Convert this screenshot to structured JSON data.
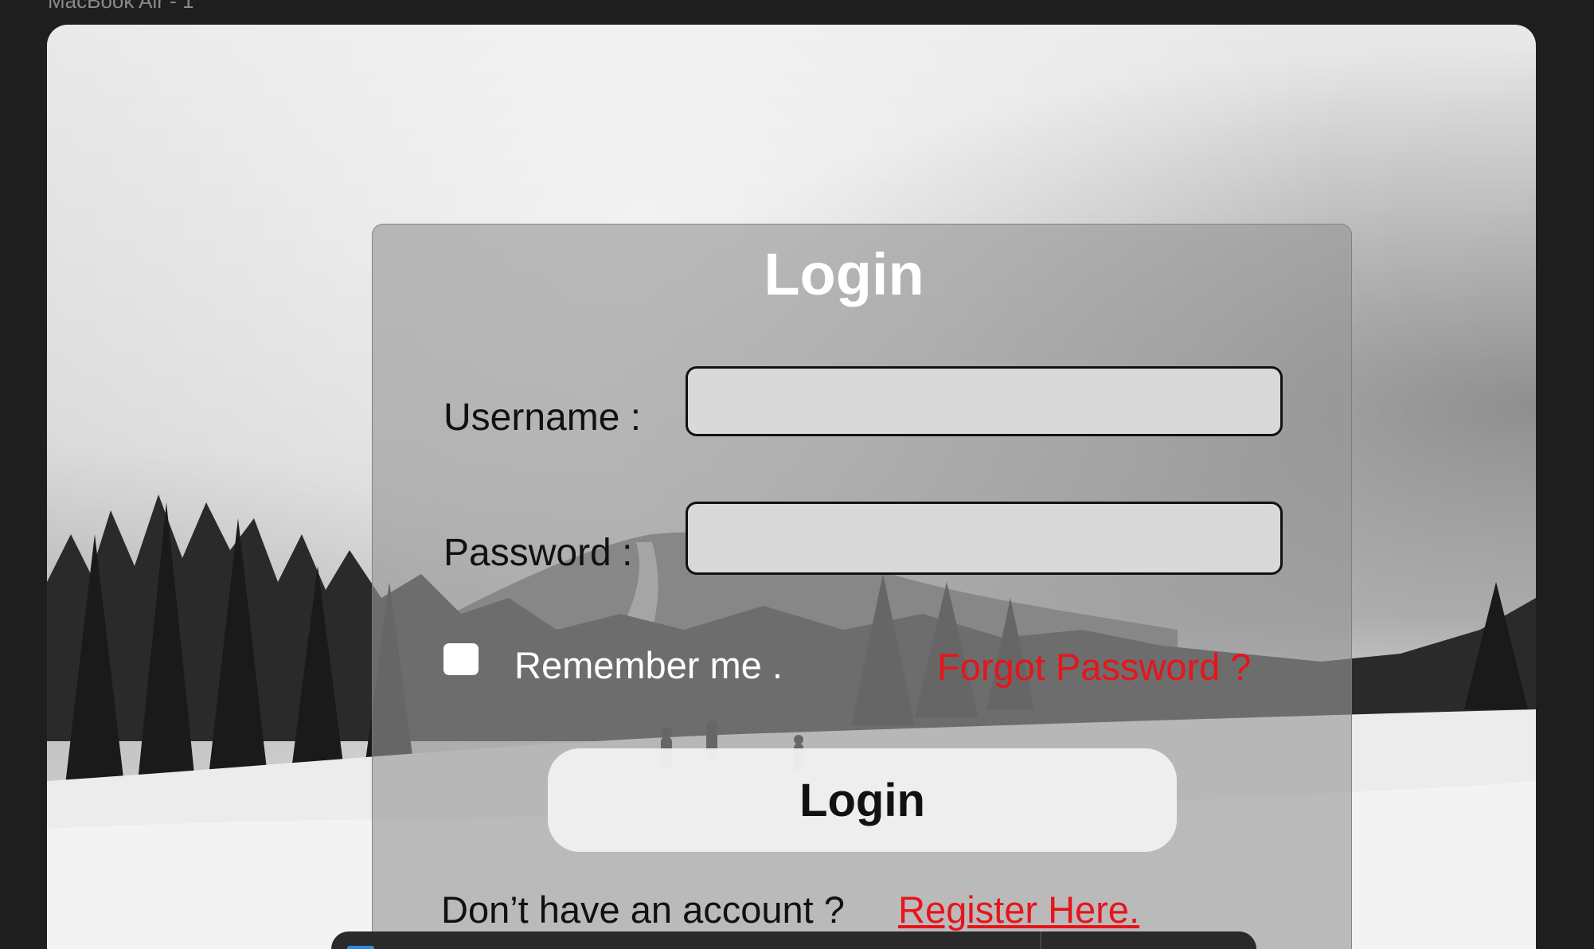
{
  "frame": {
    "label": "MacBook Air - 1"
  },
  "card": {
    "title": "Login",
    "username_label": "Username :",
    "username_value": "",
    "password_label": "Password :",
    "password_value": "",
    "remember_label": "Remember me .",
    "remember_checked": false,
    "forgot_label": "Forgot Password ?",
    "login_button": "Login",
    "no_account_text": "Don’t have an account ?",
    "register_label": "Register Here."
  },
  "colors": {
    "link_red": "#e8141a",
    "card_overlay": "#969696",
    "input_fill": "#d9d9d9",
    "canvas_bg": "#1e1e1e"
  },
  "icons": {
    "remember_checkbox": "checkbox-unchecked"
  }
}
